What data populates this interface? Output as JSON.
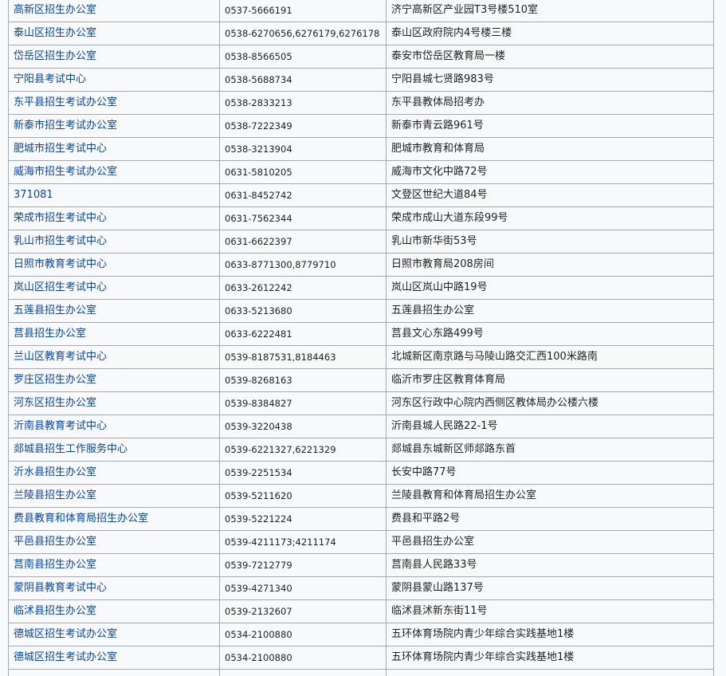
{
  "rows": [
    {
      "name": "高新区招生办公室",
      "phone": "0537-5666191",
      "address": "济宁高新区产业园T3号楼510室"
    },
    {
      "name": "泰山区招生办公室",
      "phone": "0538-6270656,6276179,6276178",
      "address": "泰山区政府院内4号楼三楼"
    },
    {
      "name": "岱岳区招生办公室",
      "phone": "0538-8566505",
      "address": "泰安市岱岳区教育局一楼"
    },
    {
      "name": "宁阳县考试中心",
      "phone": "0538-5688734",
      "address": "宁阳县城七贤路983号"
    },
    {
      "name": "东平县招生考试办公室",
      "phone": "0538-2833213",
      "address": "东平县教体局招考办"
    },
    {
      "name": "新泰市招生考试办公室",
      "phone": "0538-7222349",
      "address": "新泰市青云路961号"
    },
    {
      "name": "肥城市招生考试中心",
      "phone": "0538-3213904",
      "address": "肥城市教育和体育局"
    },
    {
      "name": "威海市招生考试办公室",
      "phone": "0631-5810205",
      "address": "威海市文化中路72号"
    },
    {
      "name": "371081",
      "phone": "0631-8452742",
      "address": "文登区世纪大道84号"
    },
    {
      "name": "荣成市招生考试中心",
      "phone": "0631-7562344",
      "address": "荣成市成山大道东段99号"
    },
    {
      "name": "乳山市招生考试中心",
      "phone": "0631-6622397",
      "address": "乳山市新华街53号"
    },
    {
      "name": "日照市教育考试中心",
      "phone": "0633-8771300,8779710",
      "address": "日照市教育局208房间"
    },
    {
      "name": "岚山区招生考试中心",
      "phone": "0633-2612242",
      "address": "岚山区岚山中路19号"
    },
    {
      "name": "五莲县招生办公室",
      "phone": "0633-5213680",
      "address": "五莲县招生办公室"
    },
    {
      "name": "莒县招生办公室",
      "phone": "0633-6222481",
      "address": "莒县文心东路499号"
    },
    {
      "name": "兰山区教育考试中心",
      "phone": "0539-8187531,8184463",
      "address": "北城新区南京路与马陵山路交汇西100米路南"
    },
    {
      "name": "罗庄区招生办公室",
      "phone": "0539-8268163",
      "address": "临沂市罗庄区教育体育局"
    },
    {
      "name": "河东区招生办公室",
      "phone": "0539-8384827",
      "address": "河东区行政中心院内西侧区教体局办公楼六楼"
    },
    {
      "name": "沂南县教育考试中心",
      "phone": "0539-3220438",
      "address": "沂南县城人民路22-1号"
    },
    {
      "name": "郯城县招生工作服务中心",
      "phone": "0539-6221327,6221329",
      "address": "郯城县东城新区师郯路东首"
    },
    {
      "name": "沂水县招生办公室",
      "phone": "0539-2251534",
      "address": "长安中路77号"
    },
    {
      "name": "兰陵县招生办公室",
      "phone": "0539-5211620",
      "address": "兰陵县教育和体育局招生办公室"
    },
    {
      "name": "费县教育和体育局招生办公室",
      "phone": "0539-5221224",
      "address": "费县和平路2号"
    },
    {
      "name": "平邑县招生办公室",
      "phone": "0539-4211173;4211174",
      "address": "平邑县招生办公室"
    },
    {
      "name": "莒南县招生办公室",
      "phone": "0539-7212779",
      "address": "莒南县人民路33号"
    },
    {
      "name": "蒙阴县教育考试中心",
      "phone": "0539-4271340",
      "address": "蒙阴县蒙山路137号"
    },
    {
      "name": "临沭县招生办公室",
      "phone": "0539-2132607",
      "address": "临沭县沭新东街11号"
    },
    {
      "name": "德城区招生考试办公室",
      "phone": "0534-2100880",
      "address": "五环体育场院内青少年综合实践基地1楼"
    },
    {
      "name": "德城区招生考试办公室",
      "phone": "0534-2100880",
      "address": "五环体育场院内青少年综合实践基地1楼"
    },
    {
      "name": "",
      "phone": "",
      "address": ""
    }
  ]
}
